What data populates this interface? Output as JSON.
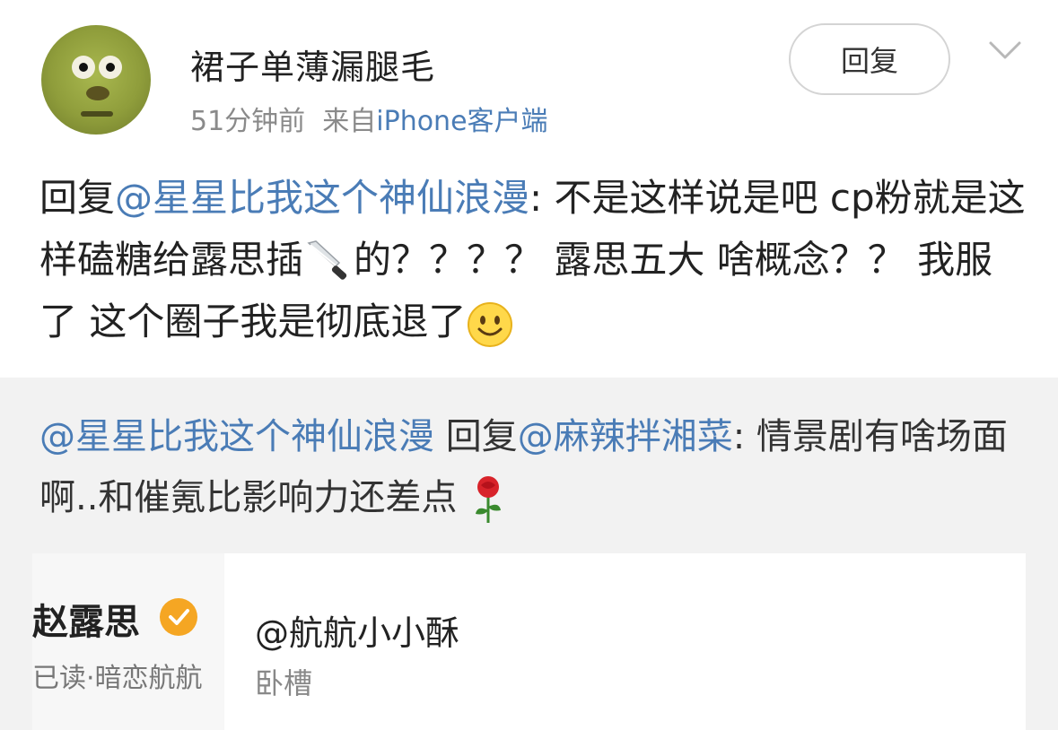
{
  "post": {
    "username": "裙子单薄漏腿毛",
    "time": "51分钟前",
    "from_label": "来自",
    "source": "iPhone客户端",
    "reply_button": "回复",
    "body": {
      "prefix": "回复",
      "mention": "@星星比我这个神仙浪漫",
      "text1": ": 不是这样说是吧 cp粉就是这样磕糖给露思插",
      "knife_emoji": "🔪",
      "text2": "的？？？？ 露思五大 啥概念？？ 我服了 这个圈子我是彻底退了",
      "smile_emoji": "🙂"
    }
  },
  "quote": {
    "mention1": "@星星比我这个神仙浪漫",
    "reply_word": " 回复",
    "mention2": "@麻辣拌湘菜",
    "text": ": 情景剧有啥场面啊..和催氪比影响力还差点",
    "rose_emoji": "🌹"
  },
  "share_card": {
    "thumb_name": "赵露思",
    "thumb_sub": "已读·暗恋航航",
    "title": "@航航小小酥",
    "desc": "卧槽"
  },
  "colors": {
    "link": "#4a7cb6",
    "meta": "#8a8a8a",
    "quote_bg": "#f2f2f2",
    "verify_badge": "#f5a623"
  },
  "icons": [
    "chevron-down-icon",
    "knife-emoji",
    "smile-emoji",
    "rose-emoji",
    "verified-badge-icon"
  ]
}
